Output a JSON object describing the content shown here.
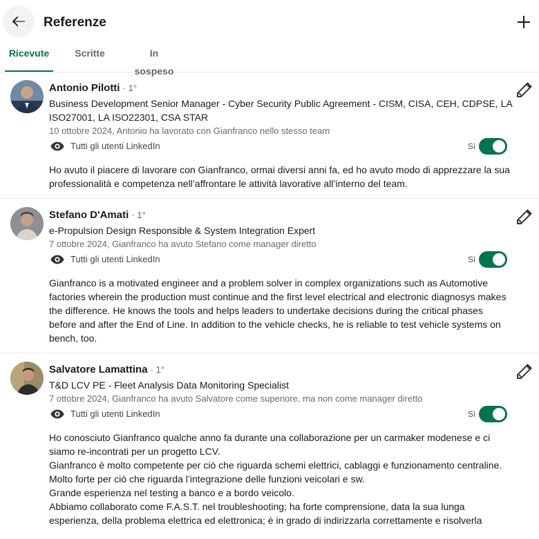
{
  "header": {
    "title": "Referenze"
  },
  "tabs": [
    {
      "label": "Ricevute",
      "active": true
    },
    {
      "label": "Scritte",
      "active": false
    },
    {
      "label": "In sospeso",
      "active": false
    }
  ],
  "colors": {
    "accent": "#01754f",
    "text": "#000000",
    "divider": "#e8e8e8"
  },
  "recommendations": [
    {
      "name": "Antonio Pilotti",
      "degree": "· 1°",
      "headline": "Business Development Senior Manager - Cyber Security Public Agreement - CISM, CISA, CEH, CDPSE, LA ISO27001, LA ISO22301, CSA STAR",
      "date": "10 ottobre 2024, Antonio ha lavorato con Gianfranco nello stesso team",
      "visibility": "Tutti gli utenti LinkedIn",
      "toggle_label": "Sì",
      "text": "Ho avuto il piacere di lavorare con Gianfranco, ormai diversi anni fa, ed ho avuto modo di apprezzare la sua professionalità e competenza nell’affrontare le attività lavorative all’interno del team."
    },
    {
      "name": "Stefano D'Amati",
      "degree": "· 1°",
      "headline": "e-Propulsion Design Responsible & System Integration Expert",
      "date": "7 ottobre 2024, Gianfranco ha avuto Stefano come manager diretto",
      "visibility": "Tutti gli utenti LinkedIn",
      "toggle_label": "Sì",
      "text": "Gianfranco is a motivated engineer and a problem solver in complex organizations such as Automotive factories wherein the production must continue and the first level electrical and electronic diagnosys makes the difference. He knows the tools and helps leaders to undertake decisions during the critical phases before and after the End of Line. In addition to the vehicle checks, he is reliable to test vehicle systems on bench, too."
    },
    {
      "name": "Salvatore Lamattina",
      "degree": "· 1°",
      "headline": "T&D LCV PE - Fleet Analysis Data Monitoring Specialist",
      "date": "7 ottobre 2024, Gianfranco ha avuto Salvatore come superiore, ma non come manager diretto",
      "visibility": "Tutti gli utenti LinkedIn",
      "toggle_label": "Sì",
      "text_lines": [
        "Ho conosciuto Gianfranco qualche anno fa durante una collaborazione per un carmaker modenese e ci siamo re-incontrati per un progetto LCV.",
        "Gianfranco è molto competente per ciò che riguarda schemi elettrici, cablaggi e funzionamento centraline.",
        "Molto forte per ciò che riguarda l’integrazione delle funzioni veicolari e sw.",
        "Grande esperienza nel testing a banco e a bordo veicolo.",
        "Abbiamo collaborato come F.A.S.T. nel troubleshooting; ha forte comprensione, data la sua lunga esperienza, della problema elettrica ed elettronica; è in grado di indirizzarla correttamente e risolverla"
      ]
    }
  ]
}
